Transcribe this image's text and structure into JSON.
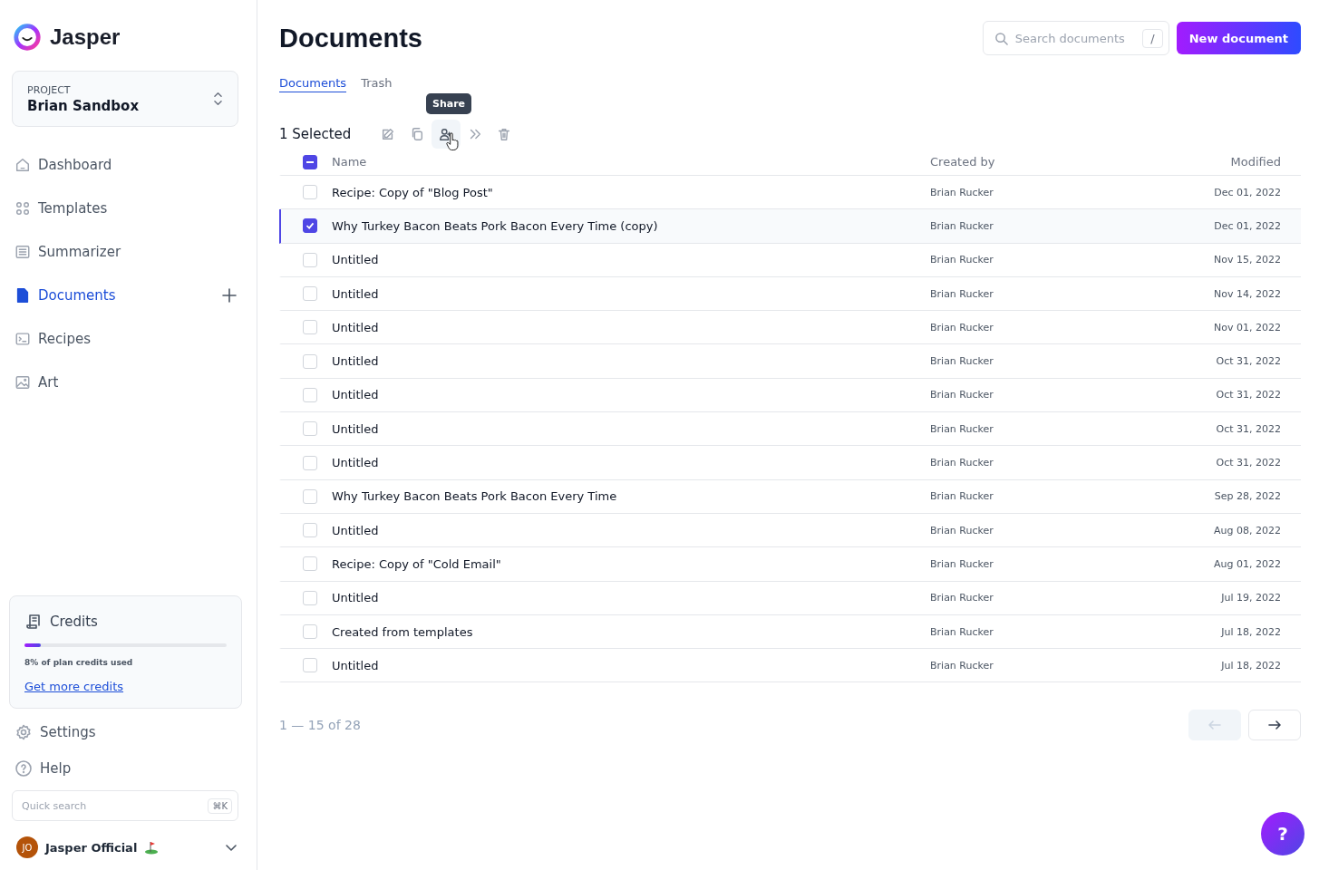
{
  "brand": {
    "name": "Jasper"
  },
  "project": {
    "label": "PROJECT",
    "name": "Brian Sandbox"
  },
  "nav": [
    {
      "label": "Dashboard",
      "selected": false,
      "add": false
    },
    {
      "label": "Templates",
      "selected": false,
      "add": false
    },
    {
      "label": "Summarizer",
      "selected": false,
      "add": false
    },
    {
      "label": "Documents",
      "selected": true,
      "add": true
    },
    {
      "label": "Recipes",
      "selected": false,
      "add": false
    },
    {
      "label": "Art",
      "selected": false,
      "add": false
    }
  ],
  "credits": {
    "title": "Credits",
    "level": 0.08,
    "caption": "8% of plan credits used",
    "link": "Get more credits"
  },
  "bottom_nav": [
    {
      "label": "Settings"
    },
    {
      "label": "Help"
    }
  ],
  "quick_search": {
    "placeholder": "Quick search",
    "shortcut": "⌘K"
  },
  "user": {
    "initials": "JO",
    "name": "Jasper Official"
  },
  "header": {
    "title": "Documents",
    "search_placeholder": "Search documents",
    "search_shortcut": "/",
    "new_button": "New document"
  },
  "tabs": [
    {
      "label": "Documents",
      "selected": true
    },
    {
      "label": "Trash",
      "selected": false
    }
  ],
  "selection": {
    "count": "1 Selected",
    "tooltip": "Share"
  },
  "tools": [
    {
      "hovered": false
    },
    {
      "hovered": false
    },
    {
      "hovered": true
    },
    {
      "hovered": false
    },
    {
      "hovered": false
    }
  ],
  "table": {
    "columns": [
      "Name",
      "Created by",
      "Modified"
    ],
    "select_all_indeterminate": true,
    "rows": [
      {
        "name": "Recipe: Copy of \"Blog Post\"",
        "created_by": "Brian Rucker",
        "modified": "Dec 01, 2022",
        "selected": false
      },
      {
        "name": "Why Turkey Bacon Beats Pork Bacon Every Time (copy)",
        "created_by": "Brian Rucker",
        "modified": "Dec 01, 2022",
        "selected": true
      },
      {
        "name": "Untitled",
        "created_by": "Brian Rucker",
        "modified": "Nov 15, 2022",
        "selected": false
      },
      {
        "name": "Untitled",
        "created_by": "Brian Rucker",
        "modified": "Nov 14, 2022",
        "selected": false
      },
      {
        "name": "Untitled",
        "created_by": "Brian Rucker",
        "modified": "Nov 01, 2022",
        "selected": false
      },
      {
        "name": "Untitled",
        "created_by": "Brian Rucker",
        "modified": "Oct 31, 2022",
        "selected": false
      },
      {
        "name": "Untitled",
        "created_by": "Brian Rucker",
        "modified": "Oct 31, 2022",
        "selected": false
      },
      {
        "name": "Untitled",
        "created_by": "Brian Rucker",
        "modified": "Oct 31, 2022",
        "selected": false
      },
      {
        "name": "Untitled",
        "created_by": "Brian Rucker",
        "modified": "Oct 31, 2022",
        "selected": false
      },
      {
        "name": "Why Turkey Bacon Beats Pork Bacon Every Time",
        "created_by": "Brian Rucker",
        "modified": "Sep 28, 2022",
        "selected": false
      },
      {
        "name": "Untitled",
        "created_by": "Brian Rucker",
        "modified": "Aug 08, 2022",
        "selected": false
      },
      {
        "name": "Recipe: Copy of \"Cold Email\"",
        "created_by": "Brian Rucker",
        "modified": "Aug 01, 2022",
        "selected": false
      },
      {
        "name": "Untitled",
        "created_by": "Brian Rucker",
        "modified": "Jul 19, 2022",
        "selected": false
      },
      {
        "name": "Created from templates",
        "created_by": "Brian Rucker",
        "modified": "Jul 18, 2022",
        "selected": false
      },
      {
        "name": "Untitled",
        "created_by": "Brian Rucker",
        "modified": "Jul 18, 2022",
        "selected": false
      }
    ]
  },
  "pagination": {
    "range": "1 — 15 of 28",
    "prev_disabled": true,
    "next_disabled": false
  },
  "help_button": "?"
}
